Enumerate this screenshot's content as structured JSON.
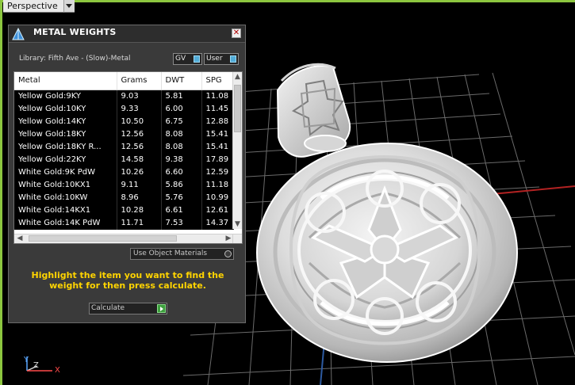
{
  "viewport": {
    "view_label": "Perspective",
    "axis_labels": {
      "y": "Y",
      "z": "Z",
      "x": "X"
    },
    "accent_color": "#8cc63f"
  },
  "metal_weights_panel": {
    "title": "METAL WEIGHTS",
    "close_glyph": "✕",
    "library": "Library: Fifth Ave - (Slow)-Metal",
    "buttons": {
      "gv": "GV",
      "user": "User"
    },
    "table": {
      "columns": [
        "Metal",
        "Grams",
        "DWT",
        "SPG"
      ],
      "rows": [
        [
          "Yellow Gold:9KY",
          "9.03",
          "5.81",
          "11.08"
        ],
        [
          "Yellow Gold:10KY",
          "9.33",
          "6.00",
          "11.45"
        ],
        [
          "Yellow Gold:14KY",
          "10.50",
          "6.75",
          "12.88"
        ],
        [
          "Yellow Gold:18KY",
          "12.56",
          "8.08",
          "15.41"
        ],
        [
          "Yellow Gold:18KY R...",
          "12.56",
          "8.08",
          "15.41"
        ],
        [
          "Yellow Gold:22KY",
          "14.58",
          "9.38",
          "17.89"
        ],
        [
          "White Gold:9K PdW",
          "10.26",
          "6.60",
          "12.59"
        ],
        [
          "White Gold:10KX1",
          "9.11",
          "5.86",
          "11.18"
        ],
        [
          "White Gold:10KW",
          "8.96",
          "5.76",
          "10.99"
        ],
        [
          "White Gold:14KX1",
          "10.28",
          "6.61",
          "12.61"
        ],
        [
          "White Gold:14K PdW",
          "11.71",
          "7.53",
          "14.37"
        ]
      ]
    },
    "use_object_materials": "Use Object Materials",
    "instruction": "Highlight the item you want to find the weight for then press calculate.",
    "calculate_button": "Calculate"
  }
}
